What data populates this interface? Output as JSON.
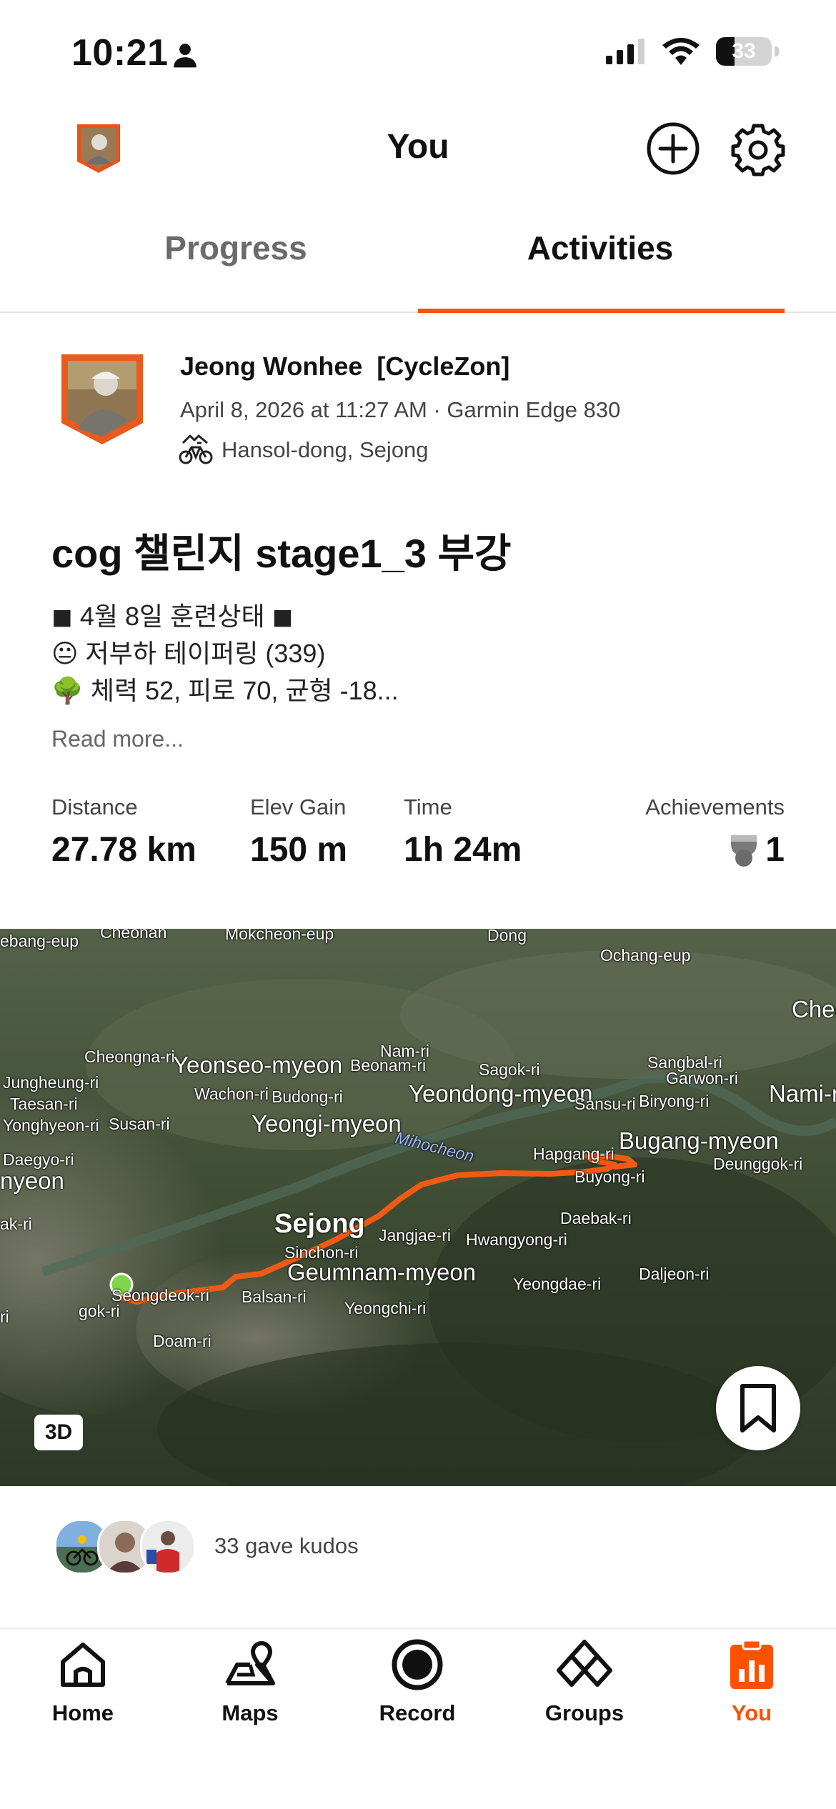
{
  "status_bar": {
    "time": "10:21",
    "battery": "33",
    "battery_level": 0.33
  },
  "header": {
    "title": "You"
  },
  "tabs": [
    {
      "label": "Progress",
      "active": false
    },
    {
      "label": "Activities",
      "active": true
    }
  ],
  "colors": {
    "accent": "#fc5200",
    "route": "#f05a14",
    "start_dot": "#7fd64b"
  },
  "activity": {
    "athlete": "Jeong Wonhee  [CycleZon]",
    "meta": "April 8, 2026 at 11:27 AM · Garmin Edge 830",
    "location": "Hansol-dong, Sejong",
    "title": "cog 챌린지 stage1_3 부강",
    "description": [
      "◼ 4월 8일 훈련상태 ◼",
      "😐 저부하 테이퍼링 (339)",
      "🌳 체력 52, 피로 70, 균형 -18..."
    ],
    "read_more": "Read more...",
    "stats": [
      {
        "label": "Distance",
        "value": "27.78 km"
      },
      {
        "label": "Elev Gain",
        "value": "150 m"
      },
      {
        "label": "Time",
        "value": "1h 24m"
      },
      {
        "label": "Achievements",
        "value": "1"
      }
    ]
  },
  "map": {
    "badge": "3D",
    "labels": {
      "mokcheon": "Mokcheon-eup",
      "dong": "Dong",
      "ochang": "Ochang-eup",
      "chec": "Chec",
      "ebang": "ebang-eup",
      "cheonan": "Cheonan",
      "cheongna": "Cheongna-ri",
      "yeonseo": "Yeonseo-myeon",
      "nam": "Nam-ri",
      "beonam": "Beonam-ri",
      "sagok": "Sagok-ri",
      "sangbal": "Sangbal-ri",
      "garwon": "Garwon-ri",
      "namimy": "Nami-my",
      "jungheung": "Jungheung-ri",
      "wachon": "Wachon-ri",
      "budong": "Budong-ri",
      "yeondong": "Yeondong-myeon",
      "sansu": "Sansu-ri",
      "biryong": "Biryong-ri",
      "taesan": "Taesan-ri",
      "yeongi": "Yeongi-myeon",
      "yonghyeon": "Yonghyeon-ri",
      "susan": "Susan-ri",
      "mihocheon": "Mihocheon",
      "bugang": "Bugang-myeon",
      "daegyo": "Daegyo-ri",
      "hapgang": "Hapgang-ri",
      "deunggok": "Deunggok-ri",
      "nyeon": "nyeon",
      "buyong": "Buyong-ri",
      "ak": "ak-ri",
      "sejong": "Sejong",
      "daebak": "Daebak-ri",
      "jangjae": "Jangjae-ri",
      "hwangyong": "Hwangyong-ri",
      "sinchon": "Sinchon-ri",
      "geumnam": "Geumnam-myeon",
      "daljeon": "Daljeon-ri",
      "yeongdae": "Yeongdae-ri",
      "seongdeok": "Seongdeok-ri",
      "balsan": "Balsan-ri",
      "yeongchi": "Yeongchi-ri",
      "ri": "ri",
      "gok": "gok-ri",
      "doam": "Doam-ri"
    }
  },
  "kudos": {
    "text": "33 gave kudos"
  },
  "nav": [
    {
      "label": "Home",
      "icon": "home-icon",
      "active": false
    },
    {
      "label": "Maps",
      "icon": "maps-icon",
      "active": false
    },
    {
      "label": "Record",
      "icon": "record-icon",
      "active": false
    },
    {
      "label": "Groups",
      "icon": "groups-icon",
      "active": false
    },
    {
      "label": "You",
      "icon": "you-icon",
      "active": true
    }
  ]
}
